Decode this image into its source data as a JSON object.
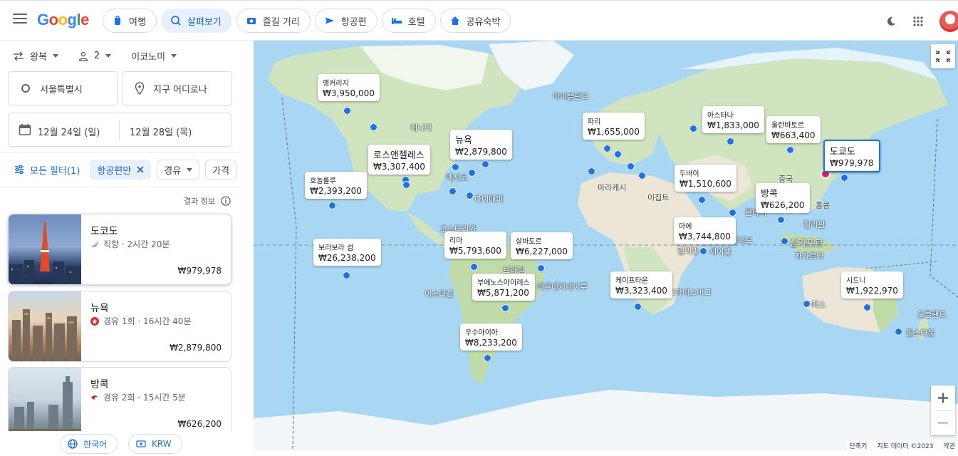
{
  "topbar": {
    "logo": "Google",
    "tabs": [
      {
        "label": "여행",
        "icon": "suitcase-icon"
      },
      {
        "label": "살펴보기",
        "icon": "explore-icon"
      },
      {
        "label": "즐길 거리",
        "icon": "camera-icon"
      },
      {
        "label": "항공편",
        "icon": "airplane-icon"
      },
      {
        "label": "호텔",
        "icon": "bed-icon"
      },
      {
        "label": "공유숙박",
        "icon": "house-icon"
      }
    ],
    "active_tab": "살펴보기"
  },
  "search": {
    "trip_type": "왕복",
    "passengers": "2",
    "cabin": "이코노미",
    "origin": "서울특별시",
    "destination_placeholder": "지구 어디로나",
    "depart_date": "12월 24일 (일)",
    "return_date": "12월 28일 (목)"
  },
  "filters": {
    "all_filters": "모든 필터(1)",
    "airline_chip": "항공편만",
    "stops_chip": "경유",
    "price_chip": "가격"
  },
  "results_info": "결과 정보",
  "results": [
    {
      "city": "도코도",
      "detail": "직항 · 2시간 20분",
      "price": "₩979,978"
    },
    {
      "city": "뉴욕",
      "detail": "경유 1회 · 16시간 40분",
      "price": "₩2,879,800"
    },
    {
      "city": "방콕",
      "detail": "경유 2회 · 15시간 5분",
      "price": "₩626,200"
    }
  ],
  "footer": {
    "language": "한국어",
    "currency": "KRW"
  },
  "map": {
    "pins": [
      {
        "name": "앵커리지",
        "price": "₩3,950,000"
      },
      {
        "name": "뉴욕",
        "price": "₩2,879,800"
      },
      {
        "name": "로스앤젤레스",
        "price": "₩3,307,400"
      },
      {
        "name": "호놀룰루",
        "price": "₩2,393,200"
      },
      {
        "name": "보라보라 섬",
        "price": "₩26,238,200"
      },
      {
        "name": "리마",
        "price": "₩5,793,600"
      },
      {
        "name": "살바도르",
        "price": "₩6,227,000"
      },
      {
        "name": "부에노스아이레스",
        "price": "₩5,871,200"
      },
      {
        "name": "우수아이아",
        "price": "₩8,233,200"
      },
      {
        "name": "파리",
        "price": "₩1,655,000"
      },
      {
        "name": "아스타나",
        "price": "₩1,833,000"
      },
      {
        "name": "울란바토르",
        "price": "₩663,400"
      },
      {
        "name": "도쿄도",
        "price": "₩979,978"
      },
      {
        "name": "두바이",
        "price": "₩1,510,600"
      },
      {
        "name": "방콕",
        "price": "₩626,200"
      },
      {
        "name": "마에",
        "price": "₩3,744,800"
      },
      {
        "name": "케이프타운",
        "price": "₩3,323,400"
      },
      {
        "name": "시드니",
        "price": "₩1,922,970"
      }
    ],
    "labels": [
      "아이슬란드",
      "캐나다",
      "멕시코",
      "마이애미",
      "코스타리카",
      "브라질",
      "리우데자네이루",
      "이스터섬",
      "마라케시",
      "이집트",
      "중국",
      "홍콩",
      "필리핀",
      "싱가포르",
      "자카르타",
      "퍼스",
      "오클랜드",
      "퀸스타운",
      "요하네스버그",
      "킬리만",
      "세이셸",
      "뭄바이",
      "몰디브"
    ],
    "attribution": [
      "단축키",
      "지도 데이터 ©2023",
      "약관"
    ]
  },
  "colors": {
    "accent": "#1a73e8",
    "selected_dot": "#e91e63",
    "water": "#a9d7f3"
  }
}
